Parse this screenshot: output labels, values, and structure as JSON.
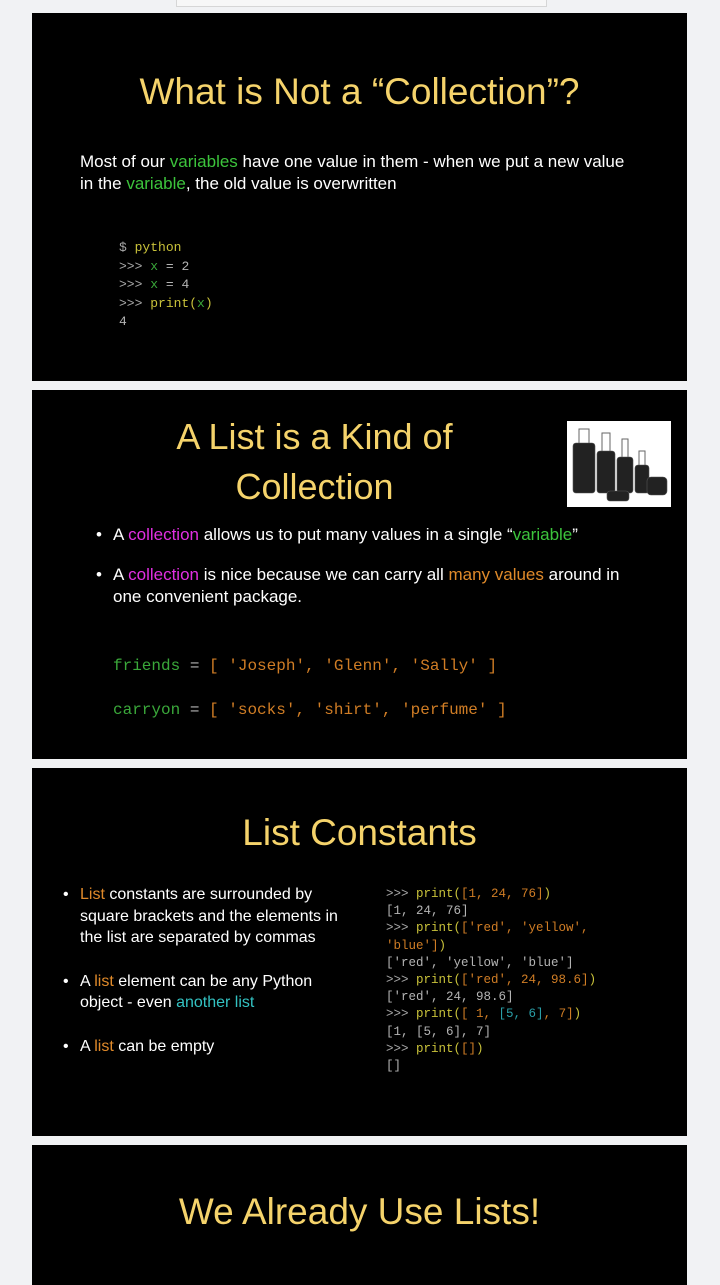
{
  "slides": [
    {
      "title": "What is Not a “Collection”?",
      "body": [
        [
          "Most of our ",
          "w"
        ],
        [
          "variables",
          "g"
        ],
        [
          " have one value in them - when we put a new value in the ",
          "w"
        ],
        [
          "variable",
          "g"
        ],
        [
          ", the old value is overwritten",
          "w"
        ]
      ],
      "code": [
        [
          [
            "$ ",
            "pr"
          ],
          [
            "python",
            "kw"
          ]
        ],
        [
          [
            ">>> ",
            "pr"
          ],
          [
            "x",
            "gr"
          ],
          [
            " = ",
            "gy"
          ],
          [
            "2",
            "gy"
          ]
        ],
        [
          [
            ">>> ",
            "pr"
          ],
          [
            "x",
            "gr"
          ],
          [
            " = ",
            "gy"
          ],
          [
            "4",
            "gy"
          ]
        ],
        [
          [
            ">>> ",
            "pr"
          ],
          [
            "print(",
            "kw"
          ],
          [
            "x",
            "gr"
          ],
          [
            ")",
            "kw"
          ]
        ],
        [
          [
            "4",
            "gy"
          ]
        ]
      ]
    },
    {
      "title": "A List is a Kind of Collection",
      "bullets": [
        [
          [
            "A ",
            "w"
          ],
          [
            "collection",
            "m"
          ],
          [
            " allows us to put many values in a single “",
            "w"
          ],
          [
            "variable",
            "g"
          ],
          [
            "”",
            "w"
          ]
        ],
        [
          [
            "A ",
            "w"
          ],
          [
            "collection",
            "m"
          ],
          [
            " is nice because we can carry all ",
            "w"
          ],
          [
            "many values",
            "o"
          ],
          [
            " around in one convenient package.",
            "w"
          ]
        ]
      ],
      "code": [
        [
          [
            "friends",
            "gr"
          ],
          [
            " = ",
            "gy"
          ],
          [
            "[ 'Joseph', 'Glenn', 'Sally' ]",
            "st"
          ]
        ],
        [
          [
            "carryon",
            "gr"
          ],
          [
            " = ",
            "gy"
          ],
          [
            "[ 'socks', 'shirt', 'perfume' ]",
            "st"
          ]
        ]
      ]
    },
    {
      "title": "List Constants",
      "bullets": [
        [
          [
            "List",
            "o"
          ],
          [
            " constants are surrounded by square brackets and the elements in the list are separated by commas",
            "w"
          ]
        ],
        [
          [
            "A ",
            "w"
          ],
          [
            "list",
            "o"
          ],
          [
            " element can be any Python object - even ",
            "w"
          ],
          [
            "another list",
            "c"
          ]
        ],
        [
          [
            "A ",
            "w"
          ],
          [
            "list",
            "o"
          ],
          [
            " can be empty",
            "w"
          ]
        ]
      ],
      "code": [
        [
          [
            ">>> ",
            "pr"
          ],
          [
            "print(",
            "kw"
          ],
          [
            "[1, 24, 76]",
            "st"
          ],
          [
            ")",
            "kw"
          ]
        ],
        [
          [
            "[1, 24, 76]",
            "gy"
          ]
        ],
        [
          [
            ">>> ",
            "pr"
          ],
          [
            "print(",
            "kw"
          ],
          [
            "['red', 'yellow',",
            "st"
          ]
        ],
        [
          [
            "'blue']",
            "st"
          ],
          [
            ")",
            "kw"
          ]
        ],
        [
          [
            "['red', 'yellow', 'blue']",
            "gy"
          ]
        ],
        [
          [
            ">>> ",
            "pr"
          ],
          [
            "print(",
            "kw"
          ],
          [
            "['red', 24, 98.6]",
            "st"
          ],
          [
            ")",
            "kw"
          ]
        ],
        [
          [
            "['red', 24, 98.6]",
            "gy"
          ]
        ],
        [
          [
            ">>> ",
            "pr"
          ],
          [
            "print(",
            "kw"
          ],
          [
            "[ 1, ",
            "st"
          ],
          [
            "[5, 6]",
            "cy"
          ],
          [
            ", 7]",
            "st"
          ],
          [
            ")",
            "kw"
          ]
        ],
        [
          [
            "[1, [5, 6], 7]",
            "gy"
          ]
        ],
        [
          [
            ">>> ",
            "pr"
          ],
          [
            "print(",
            "kw"
          ],
          [
            "[]",
            "st"
          ],
          [
            ")",
            "kw"
          ]
        ],
        [
          [
            "[]",
            "gy"
          ]
        ]
      ]
    },
    {
      "title": "We Already Use Lists!"
    }
  ]
}
